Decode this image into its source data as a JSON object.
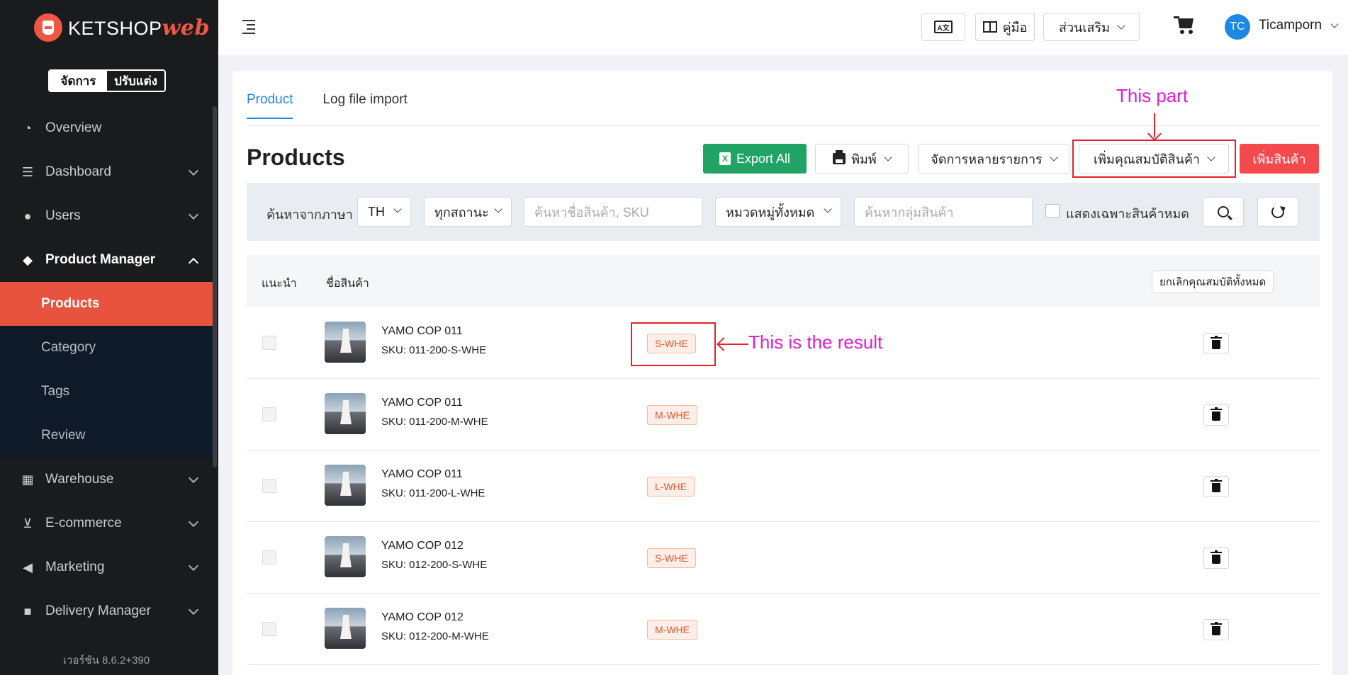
{
  "brand": {
    "name": "KETSHOP",
    "suffix": "web",
    "mode_manage": "จัดการ",
    "mode_customize": "ปรับแต่ง"
  },
  "sidebar": {
    "items": [
      {
        "label": "Overview",
        "icon": "pie-chart-icon"
      },
      {
        "label": "Dashboard",
        "icon": "bar-chart-icon"
      },
      {
        "label": "Users",
        "icon": "user-icon"
      },
      {
        "label": "Product Manager",
        "icon": "tag-icon"
      },
      {
        "label": "Warehouse",
        "icon": "warehouse-icon"
      },
      {
        "label": "E-commerce",
        "icon": "cart-icon"
      },
      {
        "label": "Marketing",
        "icon": "megaphone-icon"
      },
      {
        "label": "Delivery Manager",
        "icon": "truck-icon"
      }
    ],
    "sub_items": [
      "Products",
      "Category",
      "Tags",
      "Review"
    ],
    "version": "เวอร์ชัน 8.6.2+390"
  },
  "topbar": {
    "lang_label": "A文",
    "manual_label": "คู่มือ",
    "addons_label": "ส่วนเสริม",
    "avatar_initials": "TC",
    "username": "Ticamporn"
  },
  "tabs": [
    "Product",
    "Log file import"
  ],
  "page_title": "Products",
  "actions": {
    "export": "Export All",
    "print": "พิมพ์",
    "bulk": "จัดการหลายรายการ",
    "add_attribute": "เพิ่มคุณสมบัติสินค้า",
    "add_product": "เพิ่มสินค้า"
  },
  "filters": {
    "language_label": "ค้นหาจากภาษา",
    "language_value": "TH",
    "status_value": "ทุกสถานะ",
    "search_placeholder": "ค้นหาชื่อสินค้า, SKU",
    "category_value": "หมวดหมู่ทั้งหมด",
    "group_placeholder": "ค้นหากลุ่มสินค้า",
    "out_of_stock_label": "แสดงเฉพาะสินค้าหมด"
  },
  "table": {
    "headers": {
      "recommend": "แนะนำ",
      "name": "ชื่อสินค้า",
      "clear_all": "ยกเลิกคุณสมบัติทั้งหมด"
    },
    "rows": [
      {
        "name": "YAMO COP 011",
        "sku": "SKU: 011-200-S-WHE",
        "badge": "S-WHE"
      },
      {
        "name": "YAMO COP 011",
        "sku": "SKU: 011-200-M-WHE",
        "badge": "M-WHE"
      },
      {
        "name": "YAMO COP 011",
        "sku": "SKU: 011-200-L-WHE",
        "badge": "L-WHE"
      },
      {
        "name": "YAMO COP 012",
        "sku": "SKU: 012-200-S-WHE",
        "badge": "S-WHE"
      },
      {
        "name": "YAMO COP 012",
        "sku": "SKU: 012-200-M-WHE",
        "badge": "M-WHE"
      }
    ]
  },
  "annotations": {
    "part": "This part",
    "result": "This is the result"
  },
  "colors": {
    "accent": "#1e88e5",
    "danger": "#f4494d",
    "success": "#21a366",
    "sidebar_active": "#e8533f",
    "annotation": "#e31bd6"
  }
}
